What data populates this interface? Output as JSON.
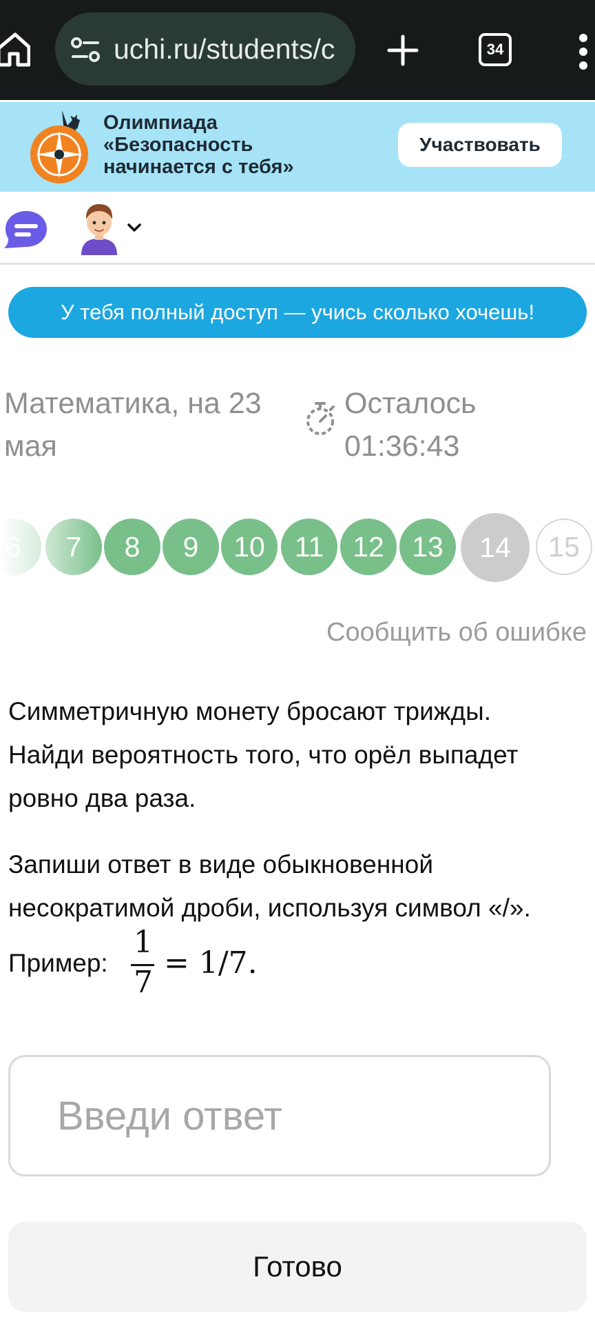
{
  "browser": {
    "url": "uchi.ru/students/c",
    "tab_count": "34",
    "icons": {
      "home": "home-icon",
      "site_info": "site-settings-icon",
      "new_tab": "plus-icon",
      "menu": "more-vert-icon"
    }
  },
  "banner": {
    "line1": "Олимпиада",
    "line2": "«Безопасность",
    "line3": "начинается с тебя»",
    "button": "Участвовать",
    "color": "#a6e3f7"
  },
  "header": {
    "icons": {
      "chat": "chat-icon",
      "avatar": "avatar",
      "dropdown": "chevron-down-icon"
    }
  },
  "access_banner": {
    "text": "У тебя полный доступ — учись сколько хочешь!",
    "color": "#1ca7e0"
  },
  "lesson": {
    "subject_line1": "Математика, на 23",
    "subject_line2": "мая",
    "timer_label": "Осталось",
    "timer_value": "01:36:43"
  },
  "question_nav": {
    "done_color": "#78bf89",
    "current_color": "#cccccc",
    "items": [
      {
        "num": "6",
        "state": "done"
      },
      {
        "num": "7",
        "state": "done"
      },
      {
        "num": "8",
        "state": "done"
      },
      {
        "num": "9",
        "state": "done"
      },
      {
        "num": "10",
        "state": "done"
      },
      {
        "num": "11",
        "state": "done"
      },
      {
        "num": "12",
        "state": "done"
      },
      {
        "num": "13",
        "state": "done"
      },
      {
        "num": "14",
        "state": "current"
      },
      {
        "num": "15",
        "state": "future"
      }
    ]
  },
  "report_link": "Сообщить об ошибке",
  "task": {
    "line1": "Симметричную монету бросают трижды.",
    "line2": "Найди вероятность того, что орёл выпадет",
    "line3": "ровно два раза.",
    "instr1": "Запиши ответ в виде обыкновенной",
    "instr2": "несократимой дроби, используя символ «/».",
    "example_label": "Пример:",
    "example_numerator": "1",
    "example_denominator": "7",
    "example_result": "= 1/7."
  },
  "answer": {
    "placeholder": "Введи ответ",
    "value": ""
  },
  "submit_button": "Готово"
}
